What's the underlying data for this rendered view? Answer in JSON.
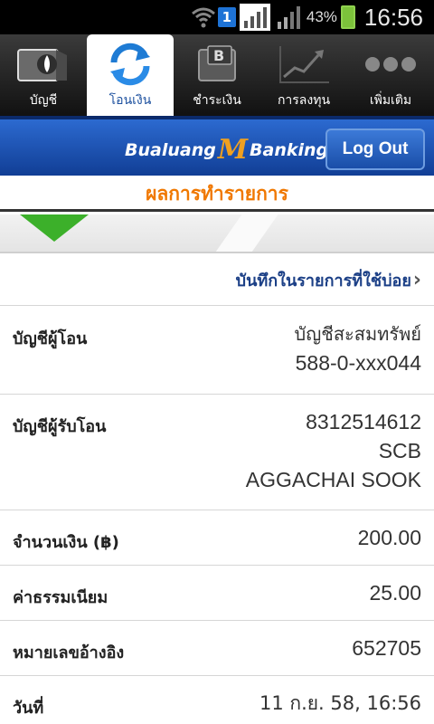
{
  "status_bar": {
    "wifi_icon": "wifi-icon",
    "badge": "1",
    "battery_percent": "43%",
    "time": "16:56"
  },
  "tabs": [
    {
      "label": "บัญชี",
      "icon": "account-icon",
      "active": false
    },
    {
      "label": "โอนเงิน",
      "icon": "transfer-icon",
      "active": true
    },
    {
      "label": "ชำระเงิน",
      "icon": "payment-icon",
      "active": false
    },
    {
      "label": "การลงทุน",
      "icon": "investment-icon",
      "active": false
    },
    {
      "label": "เพิ่มเติม",
      "icon": "more-icon",
      "active": false
    }
  ],
  "brand": {
    "left": "Bualuang",
    "m": "M",
    "right": "Banking"
  },
  "logout_label": "Log Out",
  "page_title": "ผลการทำรายการ",
  "shortcut": {
    "label": "บันทึกในรายการที่ใช้บ่อย",
    "arrow": "›"
  },
  "details": {
    "sender_label": "บัญชีผู้โอน",
    "sender_type": "บัญชีสะสมทรัพย์",
    "sender_account": "588-0-xxx044",
    "receiver_label": "บัญชีผู้รับโอน",
    "receiver_account": "8312514612",
    "receiver_bank": "SCB",
    "receiver_name": "AGGACHAI SOOK",
    "amount_label": "จำนวนเงิน (฿)",
    "amount": "200.00",
    "fee_label": "ค่าธรรมเนียม",
    "fee": "25.00",
    "reference_label": "หมายเลขอ้างอิง",
    "reference": "652705",
    "date_label": "วันที่",
    "date": "11 ก.ย. 58, 16:56"
  },
  "colors": {
    "brand_blue": "#1b4f9e",
    "title_orange": "#f07800",
    "accent_green": "#3cb02a"
  }
}
